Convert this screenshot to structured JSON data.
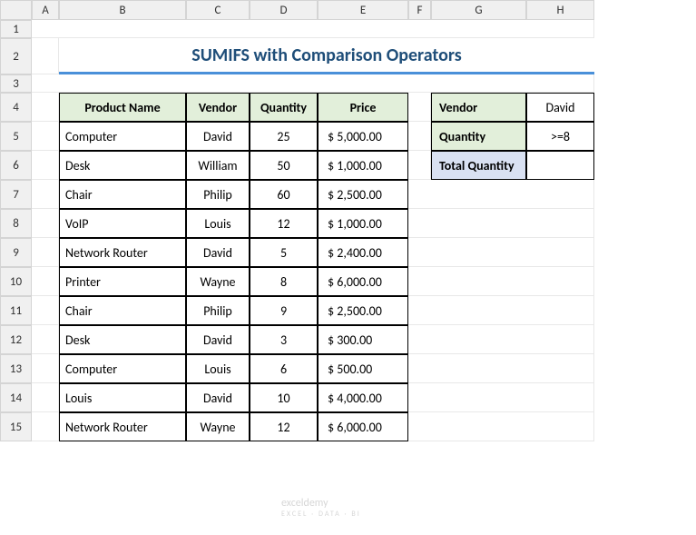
{
  "columns": [
    "A",
    "B",
    "C",
    "D",
    "E",
    "F",
    "G",
    "H"
  ],
  "rows": [
    "1",
    "2",
    "3",
    "4",
    "5",
    "6",
    "7",
    "8",
    "9",
    "10",
    "11",
    "12",
    "13",
    "14",
    "15"
  ],
  "title": "SUMIFS with Comparison Operators",
  "headers": {
    "product": "Product Name",
    "vendor": "Vendor",
    "quantity": "Quantity",
    "price": "Price"
  },
  "data": [
    {
      "product": "Computer",
      "vendor": "David",
      "qty": "25",
      "price": "$ 5,000.00"
    },
    {
      "product": "Desk",
      "vendor": "William",
      "qty": "50",
      "price": "$ 1,000.00"
    },
    {
      "product": "Chair",
      "vendor": "Philip",
      "qty": "60",
      "price": "$ 2,500.00"
    },
    {
      "product": "VoIP",
      "vendor": "Louis",
      "qty": "12",
      "price": "$ 1,000.00"
    },
    {
      "product": "Network Router",
      "vendor": "David",
      "qty": "5",
      "price": "$ 2,400.00"
    },
    {
      "product": "Printer",
      "vendor": "Wayne",
      "qty": "8",
      "price": "$ 6,000.00"
    },
    {
      "product": "Chair",
      "vendor": "Philip",
      "qty": "9",
      "price": "$ 2,500.00"
    },
    {
      "product": "Desk",
      "vendor": "David",
      "qty": "3",
      "price": "$    300.00"
    },
    {
      "product": "Computer",
      "vendor": "Louis",
      "qty": "6",
      "price": "$    500.00"
    },
    {
      "product": "Louis",
      "vendor": "David",
      "qty": "10",
      "price": "$ 4,000.00"
    },
    {
      "product": "Network Router",
      "vendor": "Wayne",
      "qty": "12",
      "price": "$ 6,000.00"
    }
  ],
  "side": {
    "vendor_label": "Vendor",
    "vendor_value": "David",
    "quantity_label": "Quantity",
    "quantity_value": ">=8",
    "total_label": "Total Quantity",
    "total_value": ""
  },
  "watermark": {
    "line1": "exceldemy",
    "line2": "EXCEL · DATA · BI"
  }
}
